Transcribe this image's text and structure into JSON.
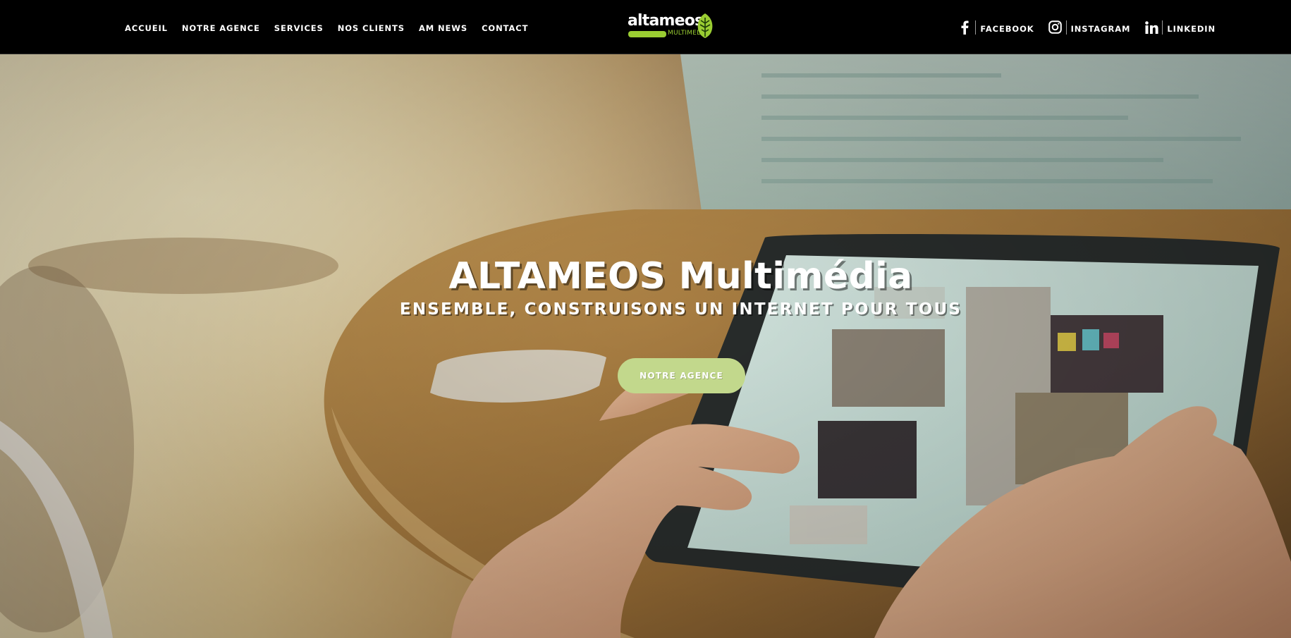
{
  "nav": {
    "items": [
      {
        "label": "ACCUEIL"
      },
      {
        "label": "NOTRE AGENCE"
      },
      {
        "label": "SERVICES"
      },
      {
        "label": "NOS CLIENTS"
      },
      {
        "label": "AM NEWS"
      },
      {
        "label": "CONTACT"
      }
    ]
  },
  "logo": {
    "word": "altameos",
    "sub": "MULTIMEDIA",
    "icon": "leaf-icon",
    "accent_color": "#9acd32"
  },
  "social": {
    "items": [
      {
        "label": "FACEBOOK",
        "icon": "facebook-icon"
      },
      {
        "label": "INSTAGRAM",
        "icon": "instagram-icon"
      },
      {
        "label": "LINKEDIN",
        "icon": "linkedin-icon"
      }
    ]
  },
  "hero": {
    "title": "ALTAMEOS Multimédia",
    "subtitle": "ENSEMBLE, CONSTRUISONS UN INTERNET POUR TOUS",
    "button_label": "NOTRE AGENCE",
    "button_color": "#c2d88c"
  },
  "colors": {
    "header_bg": "#000000",
    "text": "#ffffff"
  }
}
